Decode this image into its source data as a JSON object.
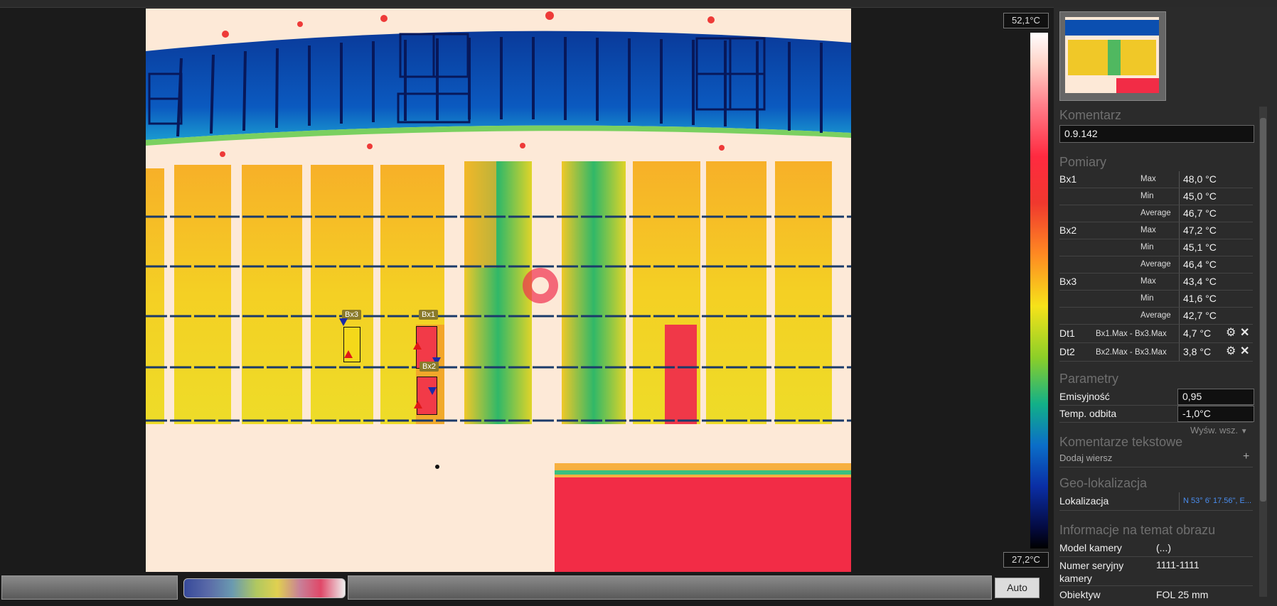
{
  "scale": {
    "max": "52,1°C",
    "min": "27,2°C"
  },
  "markers": {
    "bx1": "Bx1",
    "bx2": "Bx2",
    "bx3": "Bx3"
  },
  "panel": {
    "comment_title": "Komentarz",
    "comment_value": "0.9.142",
    "measurements_title": "Pomiary",
    "measurements": [
      {
        "name": "Bx1",
        "stat": "Max",
        "value": "48,0 °C"
      },
      {
        "name": "",
        "stat": "Min",
        "value": "45,0 °C"
      },
      {
        "name": "",
        "stat": "Average",
        "value": "46,7 °C"
      },
      {
        "name": "Bx2",
        "stat": "Max",
        "value": "47,2 °C"
      },
      {
        "name": "",
        "stat": "Min",
        "value": "45,1 °C"
      },
      {
        "name": "",
        "stat": "Average",
        "value": "46,4 °C"
      },
      {
        "name": "Bx3",
        "stat": "Max",
        "value": "43,4 °C"
      },
      {
        "name": "",
        "stat": "Min",
        "value": "41,6 °C"
      },
      {
        "name": "",
        "stat": "Average",
        "value": "42,7 °C"
      }
    ],
    "deltas": [
      {
        "name": "Dt1",
        "expr": "Bx1.Max - Bx3.Max",
        "value": "4,7 °C"
      },
      {
        "name": "Dt2",
        "expr": "Bx2.Max - Bx3.Max",
        "value": "3,8 °C"
      }
    ],
    "params_title": "Parametry",
    "emissivity_label": "Emisyjność",
    "emissivity_value": "0,95",
    "reflected_label": "Temp. odbita",
    "reflected_value": "-1,0°C",
    "show_all": "Wyśw. wsz.",
    "text_comments_title": "Komentarze tekstowe",
    "add_row": "Dodaj wiersz",
    "geo_title": "Geo-lokalizacja",
    "location_label": "Lokalizacja",
    "location_value": "N 53° 6' 17.56\", E...",
    "info_title": "Informacje na temat obrazu",
    "camera_model_label": "Model kamery",
    "camera_model_value": "(...)",
    "serial_label": "Numer seryjny kamery",
    "serial_value": "1111-1111",
    "lens_label": "Obiektyw",
    "lens_value": "FOL 25 mm"
  },
  "bottom": {
    "auto": "Auto"
  }
}
